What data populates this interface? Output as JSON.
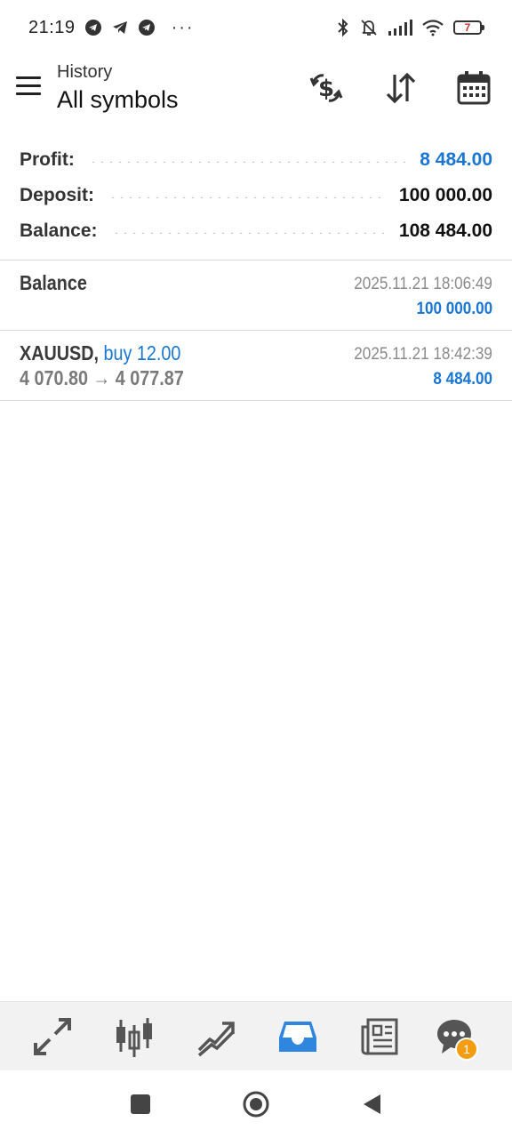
{
  "status_bar": {
    "time": "21:19",
    "more": "···",
    "battery": "7",
    "icons": [
      "telegram-icon",
      "telegram-icon",
      "telegram-icon",
      "bluetooth-icon",
      "bell-off-icon",
      "signal-icon",
      "wifi-icon",
      "battery-icon"
    ]
  },
  "header": {
    "subtitle": "History",
    "title": "All symbols",
    "icons": [
      "currency-exchange-icon",
      "sort-icon",
      "calendar-icon"
    ]
  },
  "summary": {
    "profit_label": "Profit:",
    "profit_value": "8 484.00",
    "deposit_label": "Deposit:",
    "deposit_value": "100 000.00",
    "balance_label": "Balance:",
    "balance_value": "108 484.00"
  },
  "deals": [
    {
      "title": "Balance",
      "time": "2025.11.21 18:06:49",
      "amount": "100 000.00"
    },
    {
      "symbol": "XAUUSD,",
      "type": " buy 12.00",
      "prices": "4 070.80 → 4 077.87",
      "time": "2025.11.21 18:42:39",
      "amount": "8 484.00"
    }
  ],
  "bottom_nav": {
    "items": [
      "quotes-icon",
      "chart-icon",
      "trade-icon",
      "history-icon",
      "news-icon",
      "chat-icon"
    ],
    "active": "history-icon",
    "chat_badge": "1"
  },
  "colors": {
    "accent": "#1976d2",
    "badge": "#f39c12",
    "nav_bg": "#f2f2f2"
  }
}
